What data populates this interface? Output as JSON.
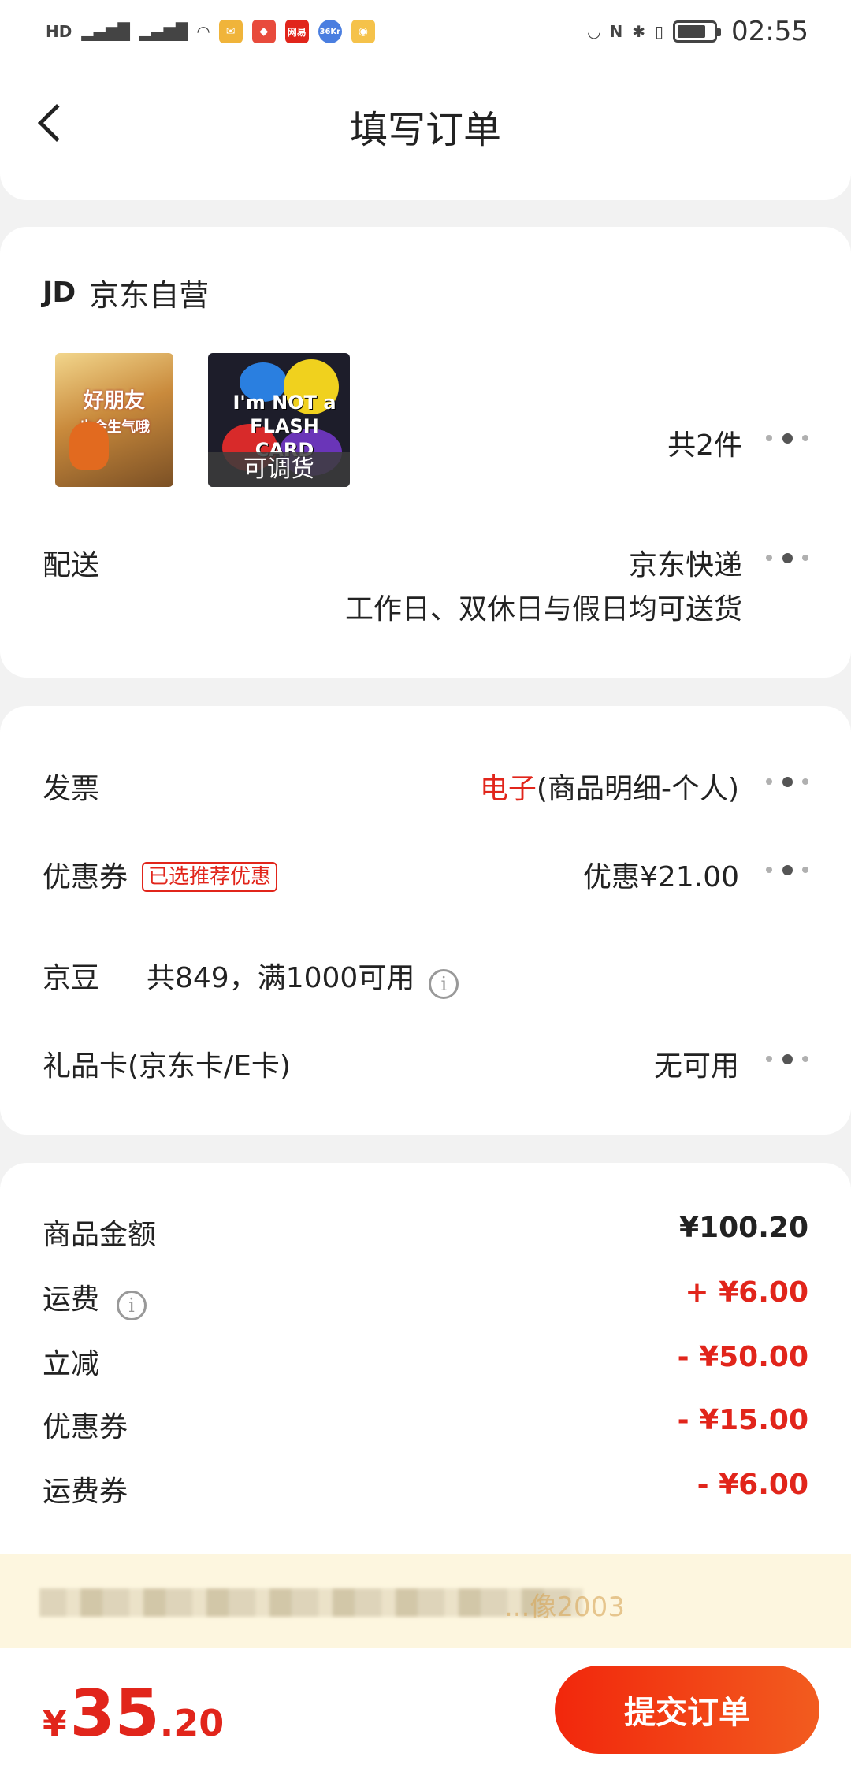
{
  "status_bar": {
    "left_icons": [
      "HD",
      "4G",
      "2G",
      "wifi-icon",
      "mail-icon",
      "app-icon",
      "网易",
      "36Kr",
      "notes-icon"
    ],
    "time": "02:55"
  },
  "header": {
    "title": "填写订单"
  },
  "store": {
    "logo": "JD",
    "name": "京东自营"
  },
  "products": {
    "item1_title": "好朋友",
    "item1_subtitle": "也会生气哦",
    "item2_title": "I'm NOT a FLASH CARD",
    "item2_tag": "可调货",
    "count": "共2件"
  },
  "delivery": {
    "label": "配送",
    "method": "京东快递",
    "note": "工作日、双休日与假日均可送货"
  },
  "invoice": {
    "label": "发票",
    "type": "电子",
    "detail": "(商品明细-个人)"
  },
  "coupon": {
    "label": "优惠券",
    "badge": "已选推荐优惠",
    "value": "优惠¥21.00"
  },
  "jingdou": {
    "label": "京豆",
    "text": "共849，满1000可用"
  },
  "gift_card": {
    "label": "礼品卡(京东卡/E卡)",
    "value": "无可用"
  },
  "summary": [
    {
      "label": "商品金额",
      "value": "¥100.20",
      "color": "#222222"
    },
    {
      "label": "运费",
      "value": "+ ¥6.00",
      "color": "#e1251b"
    },
    {
      "label": "立减",
      "value": "- ¥50.00",
      "color": "#e1251b"
    },
    {
      "label": "优惠券",
      "value": "- ¥15.00",
      "color": "#e1251b"
    },
    {
      "label": "运费券",
      "value": "- ¥6.00",
      "color": "#e1251b"
    }
  ],
  "notice": {
    "visible_text": "...像2003"
  },
  "footer": {
    "currency": "¥",
    "total_int": "35",
    "total_dec": ".20",
    "submit_label": "提交订单"
  },
  "colors": {
    "accent": "#e1251b",
    "background": "#f2f2f2"
  }
}
